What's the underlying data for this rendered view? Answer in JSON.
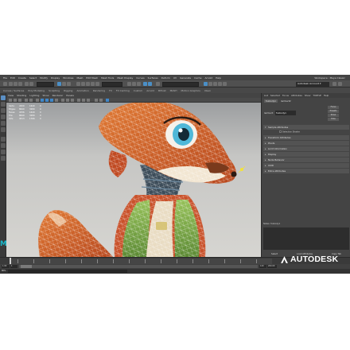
{
  "menubar": {
    "items": [
      "File",
      "Edit",
      "Create",
      "Select",
      "Modify",
      "Display",
      "Windows",
      "Mesh",
      "Edit Mesh",
      "Mesh Tools",
      "Mesh Display",
      "Curves",
      "Surfaces",
      "Deform",
      "UV",
      "Generate",
      "Cache",
      "Arnold",
      "Help"
    ],
    "workspace": "Workspace : Maya Classic"
  },
  "statusline": {
    "sign_in": "Autodesk Account ▾",
    "live": "No Live Surface"
  },
  "shelf_tabs": [
    "Curves / Surfaces",
    "Poly Modeling",
    "Sculpting",
    "Rigging",
    "Animation",
    "Rendering",
    "FX",
    "FX Caching",
    "Custom",
    "Arnold",
    "Bifrost",
    "MASH",
    "Motion Graphics",
    "XGen"
  ],
  "panel_menu": [
    "View",
    "Shading",
    "Lighting",
    "Show",
    "Renderer",
    "Panels"
  ],
  "hud": [
    [
      "Verts:",
      "4320",
      "1640",
      "0"
    ],
    [
      "Edges:",
      "8640",
      "3280",
      "0"
    ],
    [
      "Faces:",
      "4336",
      "1640",
      "0"
    ],
    [
      "Tris:",
      "8640",
      "3280",
      "0"
    ],
    [
      "UVs:",
      "4513",
      "1766",
      "0"
    ]
  ],
  "attribute_editor": {
    "tabs": [
      "List",
      "Selected",
      "Focus",
      "Attributes",
      "Show",
      "TURTLE",
      "Help"
    ],
    "node_tabs": [
      "foxbody1",
      "lambert2"
    ],
    "node_label": "lambert:",
    "node_value": "foxbody1",
    "focus_button": "Focus",
    "presets_button": "Presets",
    "show_button": "Show",
    "hide_button": "Hide",
    "sections": [
      {
        "label": "Sample Attributes",
        "open": true
      },
      {
        "label": "Transform Attributes",
        "open": false
      },
      {
        "label": "Pivots",
        "open": false
      },
      {
        "label": "Limit Information",
        "open": false
      },
      {
        "label": "Display",
        "open": false
      },
      {
        "label": "Node Behavior",
        "open": false
      },
      {
        "label": "UUID",
        "open": false
      },
      {
        "label": "Extra Attributes",
        "open": false
      }
    ],
    "checkbox_label": "Selection Shader",
    "notes_label": "Notes: foxbody1",
    "bottom_buttons": [
      "Select",
      "Load Attributes",
      "Copy Tab"
    ]
  },
  "timeline": {
    "start": "1",
    "end": "120",
    "range_start": "1.00",
    "range_end": "200.00",
    "current_frame": "1",
    "anim_layer": "No Anim Layer",
    "char_set": "No Character Set"
  },
  "cmdline": {
    "label": "MEL"
  },
  "brand": {
    "name": "AUTODESK",
    "maya_letter": "M"
  },
  "colors": {
    "accent_blue": "#4a8fc7",
    "maya_teal": "#19b7c9",
    "fox_orange": "#d9652a",
    "vest_green": "#7fae4a",
    "eye_blue": "#4fb8d8"
  }
}
